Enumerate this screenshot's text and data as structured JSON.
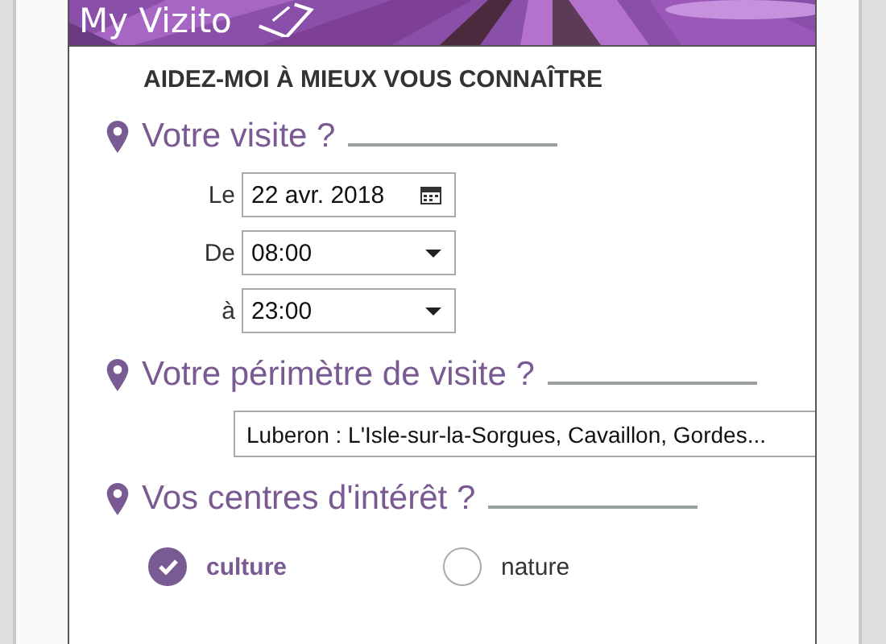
{
  "header": {
    "logo": "My Vizito"
  },
  "title": "AIDEZ-MOI À MIEUX VOUS CONNAÎTRE",
  "sections": [
    {
      "heading": "Votre visite ?",
      "fields": [
        {
          "label": "Le",
          "value": "22 avr. 2018",
          "kind": "date"
        },
        {
          "label": "De",
          "value": "08:00",
          "kind": "select"
        },
        {
          "label": "à",
          "value": "23:00",
          "kind": "select"
        }
      ]
    },
    {
      "heading": "Votre périmètre de visite ?",
      "fields": [
        {
          "value": "Luberon : L'Isle-sur-la-Sorgues, Cavaillon, Gordes...",
          "kind": "text"
        }
      ]
    },
    {
      "heading": "Vos centres d'intérêt ?",
      "options": [
        {
          "label": "culture",
          "checked": true
        },
        {
          "label": "nature",
          "checked": false
        }
      ]
    }
  ]
}
